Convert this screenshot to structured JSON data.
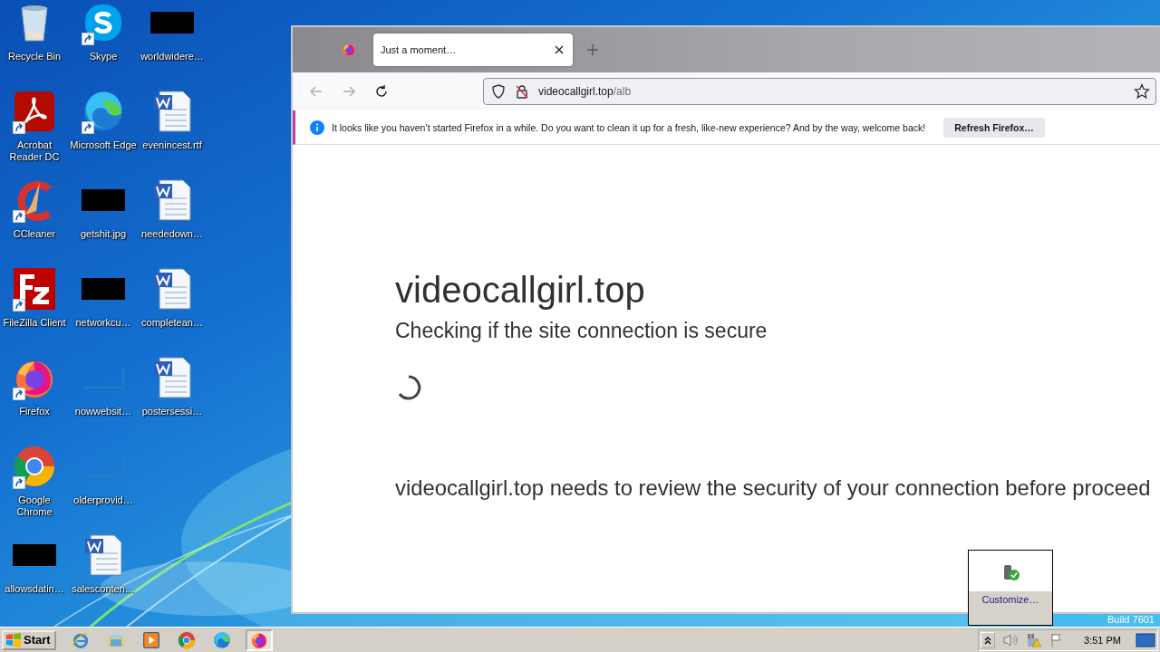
{
  "desktop": {
    "icons": [
      {
        "kind": "recycle",
        "label": "Recycle Bin",
        "shortcut": false
      },
      {
        "kind": "pdf",
        "label": "Acrobat Reader DC",
        "shortcut": true
      },
      {
        "kind": "ccleaner",
        "label": "CCleaner",
        "shortcut": true
      },
      {
        "kind": "filezilla",
        "label": "FileZilla Client",
        "shortcut": true
      },
      {
        "kind": "firefox",
        "label": "Firefox",
        "shortcut": true
      },
      {
        "kind": "chrome",
        "label": "Google Chrome",
        "shortcut": true
      },
      {
        "kind": "black",
        "label": "allowsdatin…",
        "shortcut": false
      },
      {
        "kind": "skype",
        "label": "Skype",
        "shortcut": true
      },
      {
        "kind": "edge",
        "label": "Microsoft Edge",
        "shortcut": true
      },
      {
        "kind": "black",
        "label": "getshit.jpg",
        "shortcut": false
      },
      {
        "kind": "black",
        "label": "networkcu…",
        "shortcut": false
      },
      {
        "kind": "blank",
        "label": "nowwebsit…",
        "shortcut": false
      },
      {
        "kind": "blank",
        "label": "olderprovid…",
        "shortcut": false
      },
      {
        "kind": "word",
        "label": "salesconten…",
        "shortcut": false
      },
      {
        "kind": "black",
        "label": "worldwidere…",
        "shortcut": false
      },
      {
        "kind": "word",
        "label": "evenincest.rtf",
        "shortcut": false
      },
      {
        "kind": "word",
        "label": "neededown…",
        "shortcut": false
      },
      {
        "kind": "word",
        "label": "completean…",
        "shortcut": false
      },
      {
        "kind": "word",
        "label": "postersessi…",
        "shortcut": false
      }
    ],
    "build_label": "Build 7601"
  },
  "browser": {
    "tabs": [
      {
        "title": "Just a moment…",
        "selected": true
      }
    ],
    "nav_buttons": [
      {
        "kind": "back",
        "disabled": true
      },
      {
        "kind": "forward",
        "disabled": true
      },
      {
        "kind": "reload",
        "disabled": false
      }
    ],
    "url": {
      "host": "videocallgirl.top",
      "path": "/alb"
    },
    "notification": {
      "text": "It looks like you haven’t started Firefox in a while. Do you want to clean it up for a fresh, like-new experience? And by the way, welcome back!",
      "button": "Refresh Firefox…"
    },
    "page": {
      "heading": "videocallgirl.top",
      "subheading": "Checking if the site connection is secure",
      "message": "videocallgirl.top needs to review the security of your connection before proceed"
    }
  },
  "tray_popup": {
    "button": "Customize…"
  },
  "taskbar": {
    "start": "Start",
    "apps": [
      {
        "kind": "ie",
        "active": false
      },
      {
        "kind": "explorer",
        "active": false
      },
      {
        "kind": "media",
        "active": false
      },
      {
        "kind": "chrome",
        "active": false
      },
      {
        "kind": "edge",
        "active": false
      },
      {
        "kind": "firefox",
        "active": true
      }
    ],
    "clock": "3:51 PM"
  }
}
